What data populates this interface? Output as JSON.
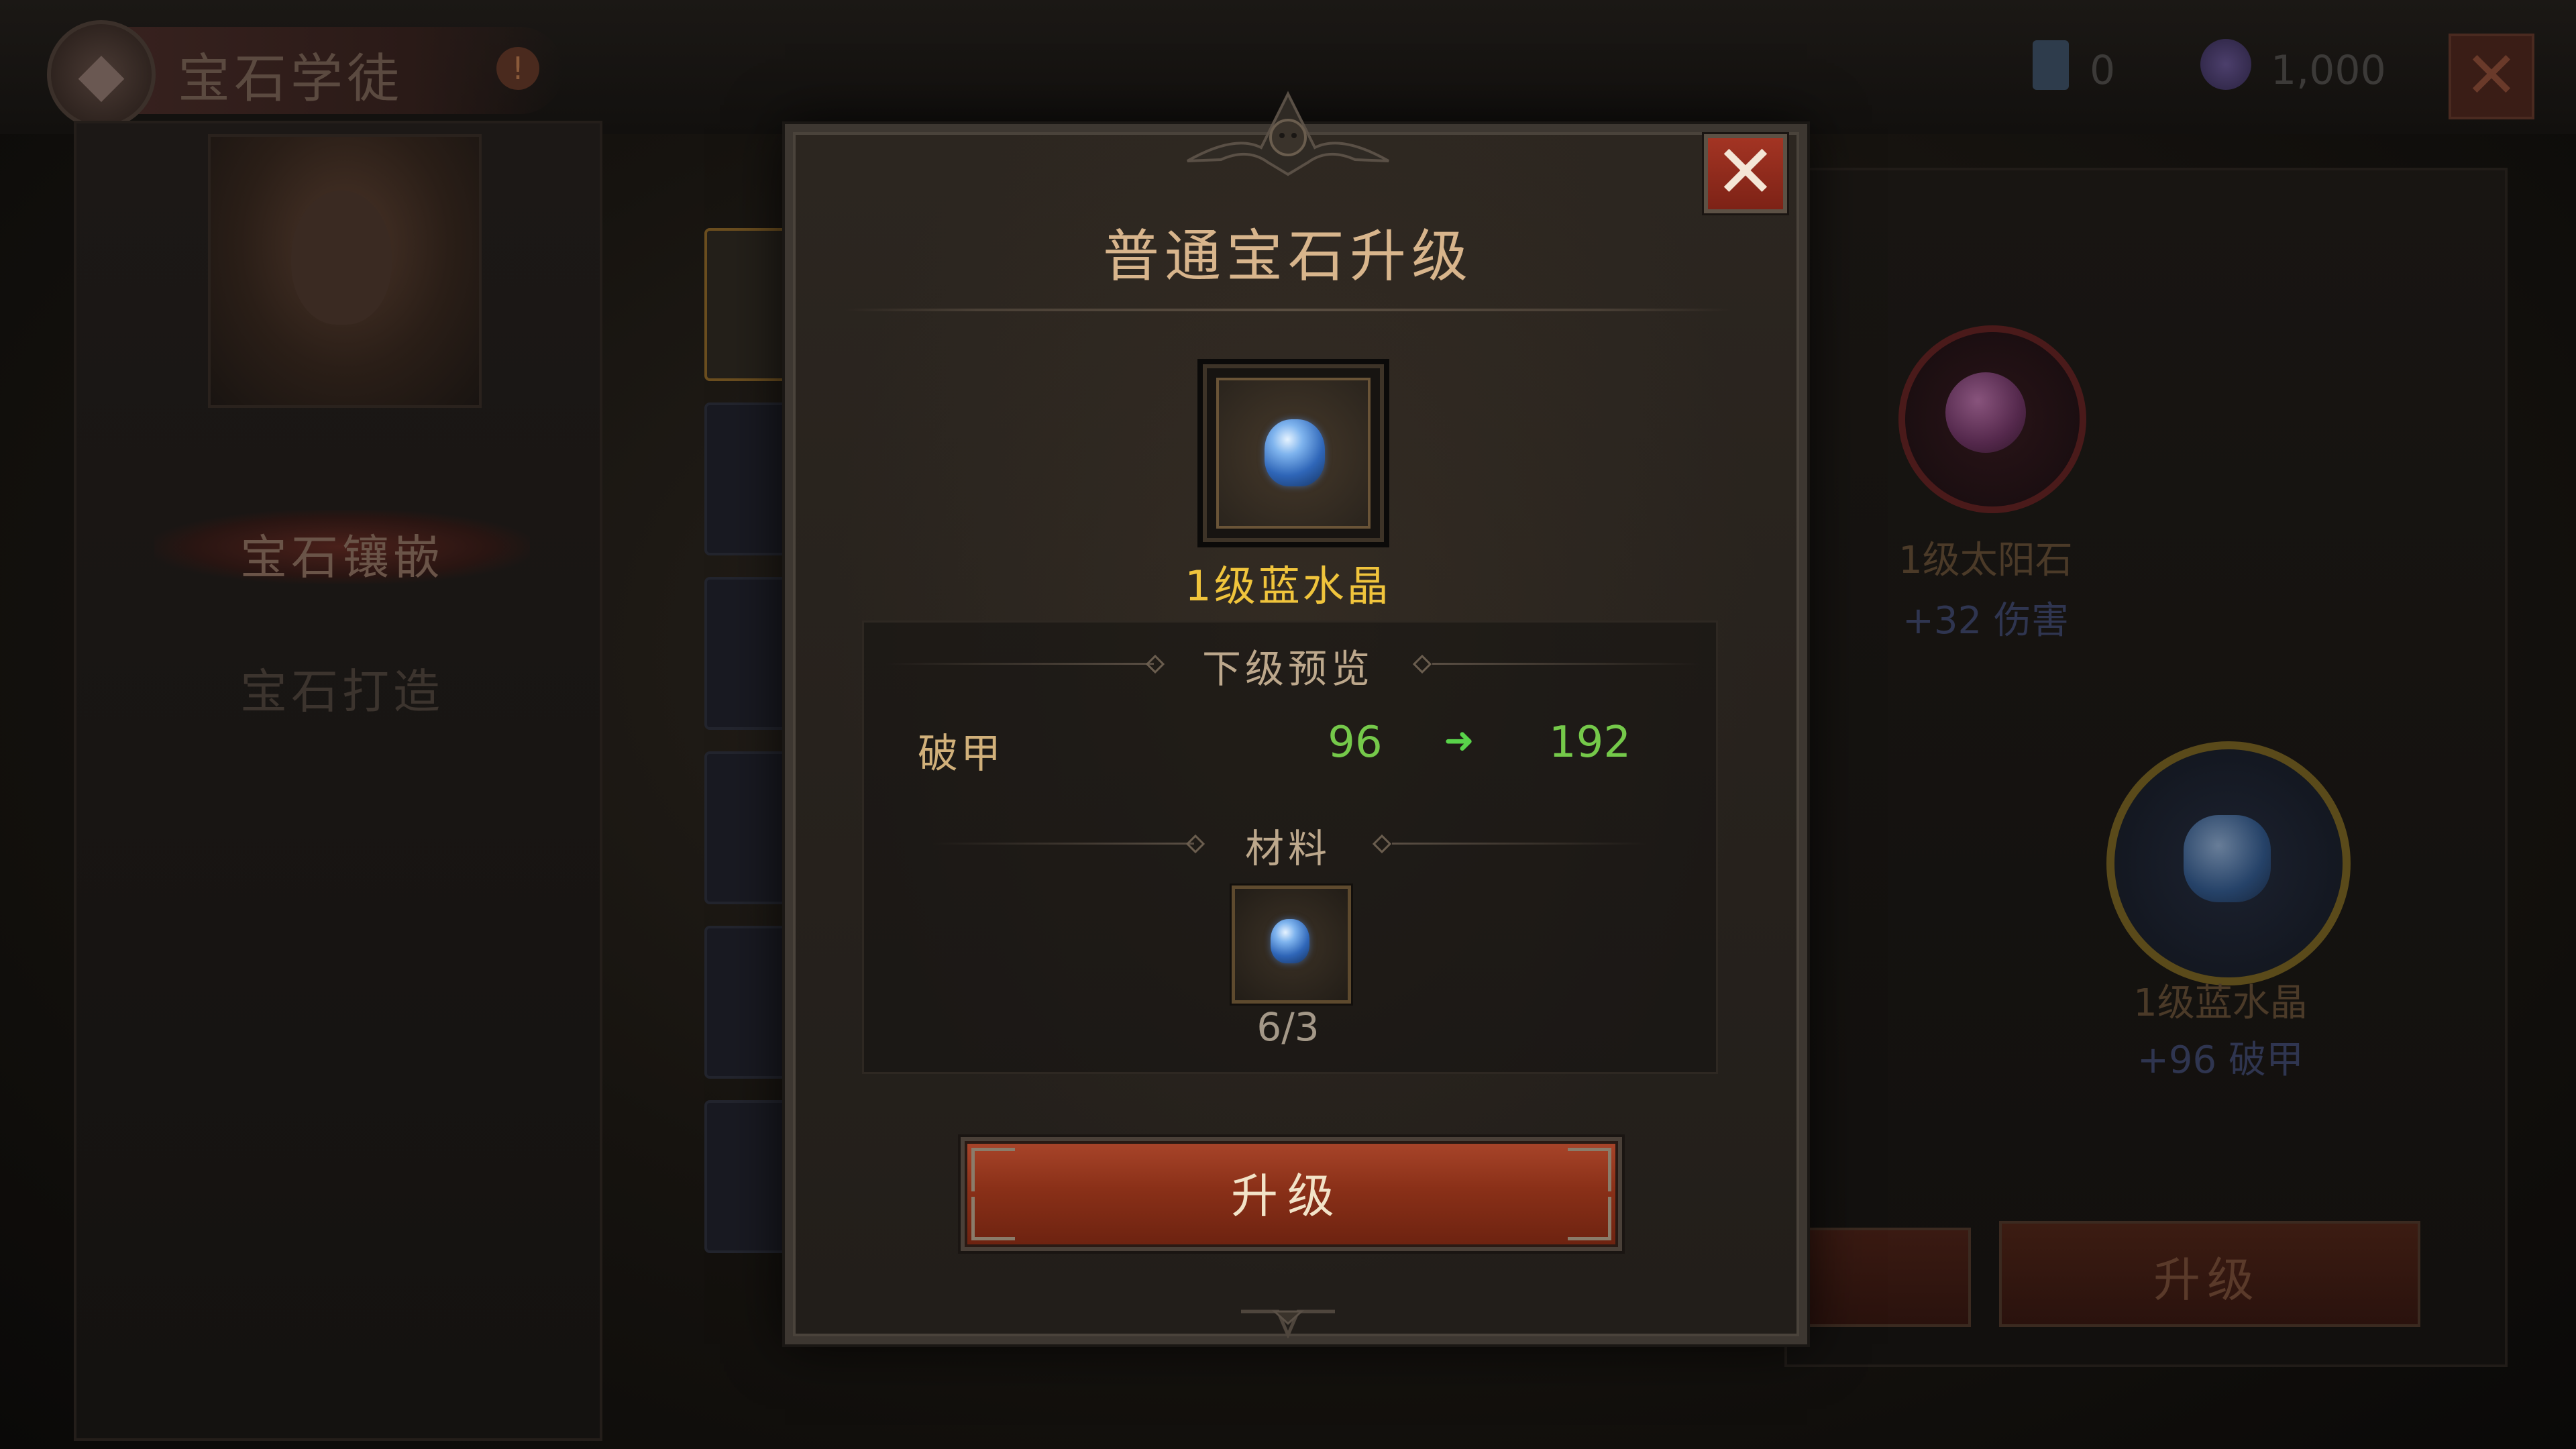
{
  "background": {
    "title": "宝石学徒",
    "currency_1_value": "0",
    "currency_2_value": "1,000",
    "nav_active": "宝石镶嵌",
    "nav_inactive": "宝石打造",
    "gem_sun_name": "1级太阳石",
    "gem_sun_bonus": "+32 伤害",
    "gem_blue_name": "1级蓝水晶",
    "gem_blue_bonus": "+96 破甲",
    "upgrade_button": "升级"
  },
  "modal": {
    "title": "普通宝石升级",
    "gem_name": "1级蓝水晶",
    "preview_label": "下级预览",
    "stat": {
      "name": "破甲",
      "current": "96",
      "next": "192"
    },
    "materials_label": "材料",
    "material_count": "6/3",
    "upgrade_button": "升级"
  },
  "colors": {
    "accent_gold": "#f0c43c",
    "stat_green": "#75c94a",
    "button_red": "#8a3018",
    "close_red": "#a33423"
  },
  "icons": [
    "close-icon",
    "blue-crystal-icon",
    "arrow-right-icon",
    "ornament-crest"
  ]
}
